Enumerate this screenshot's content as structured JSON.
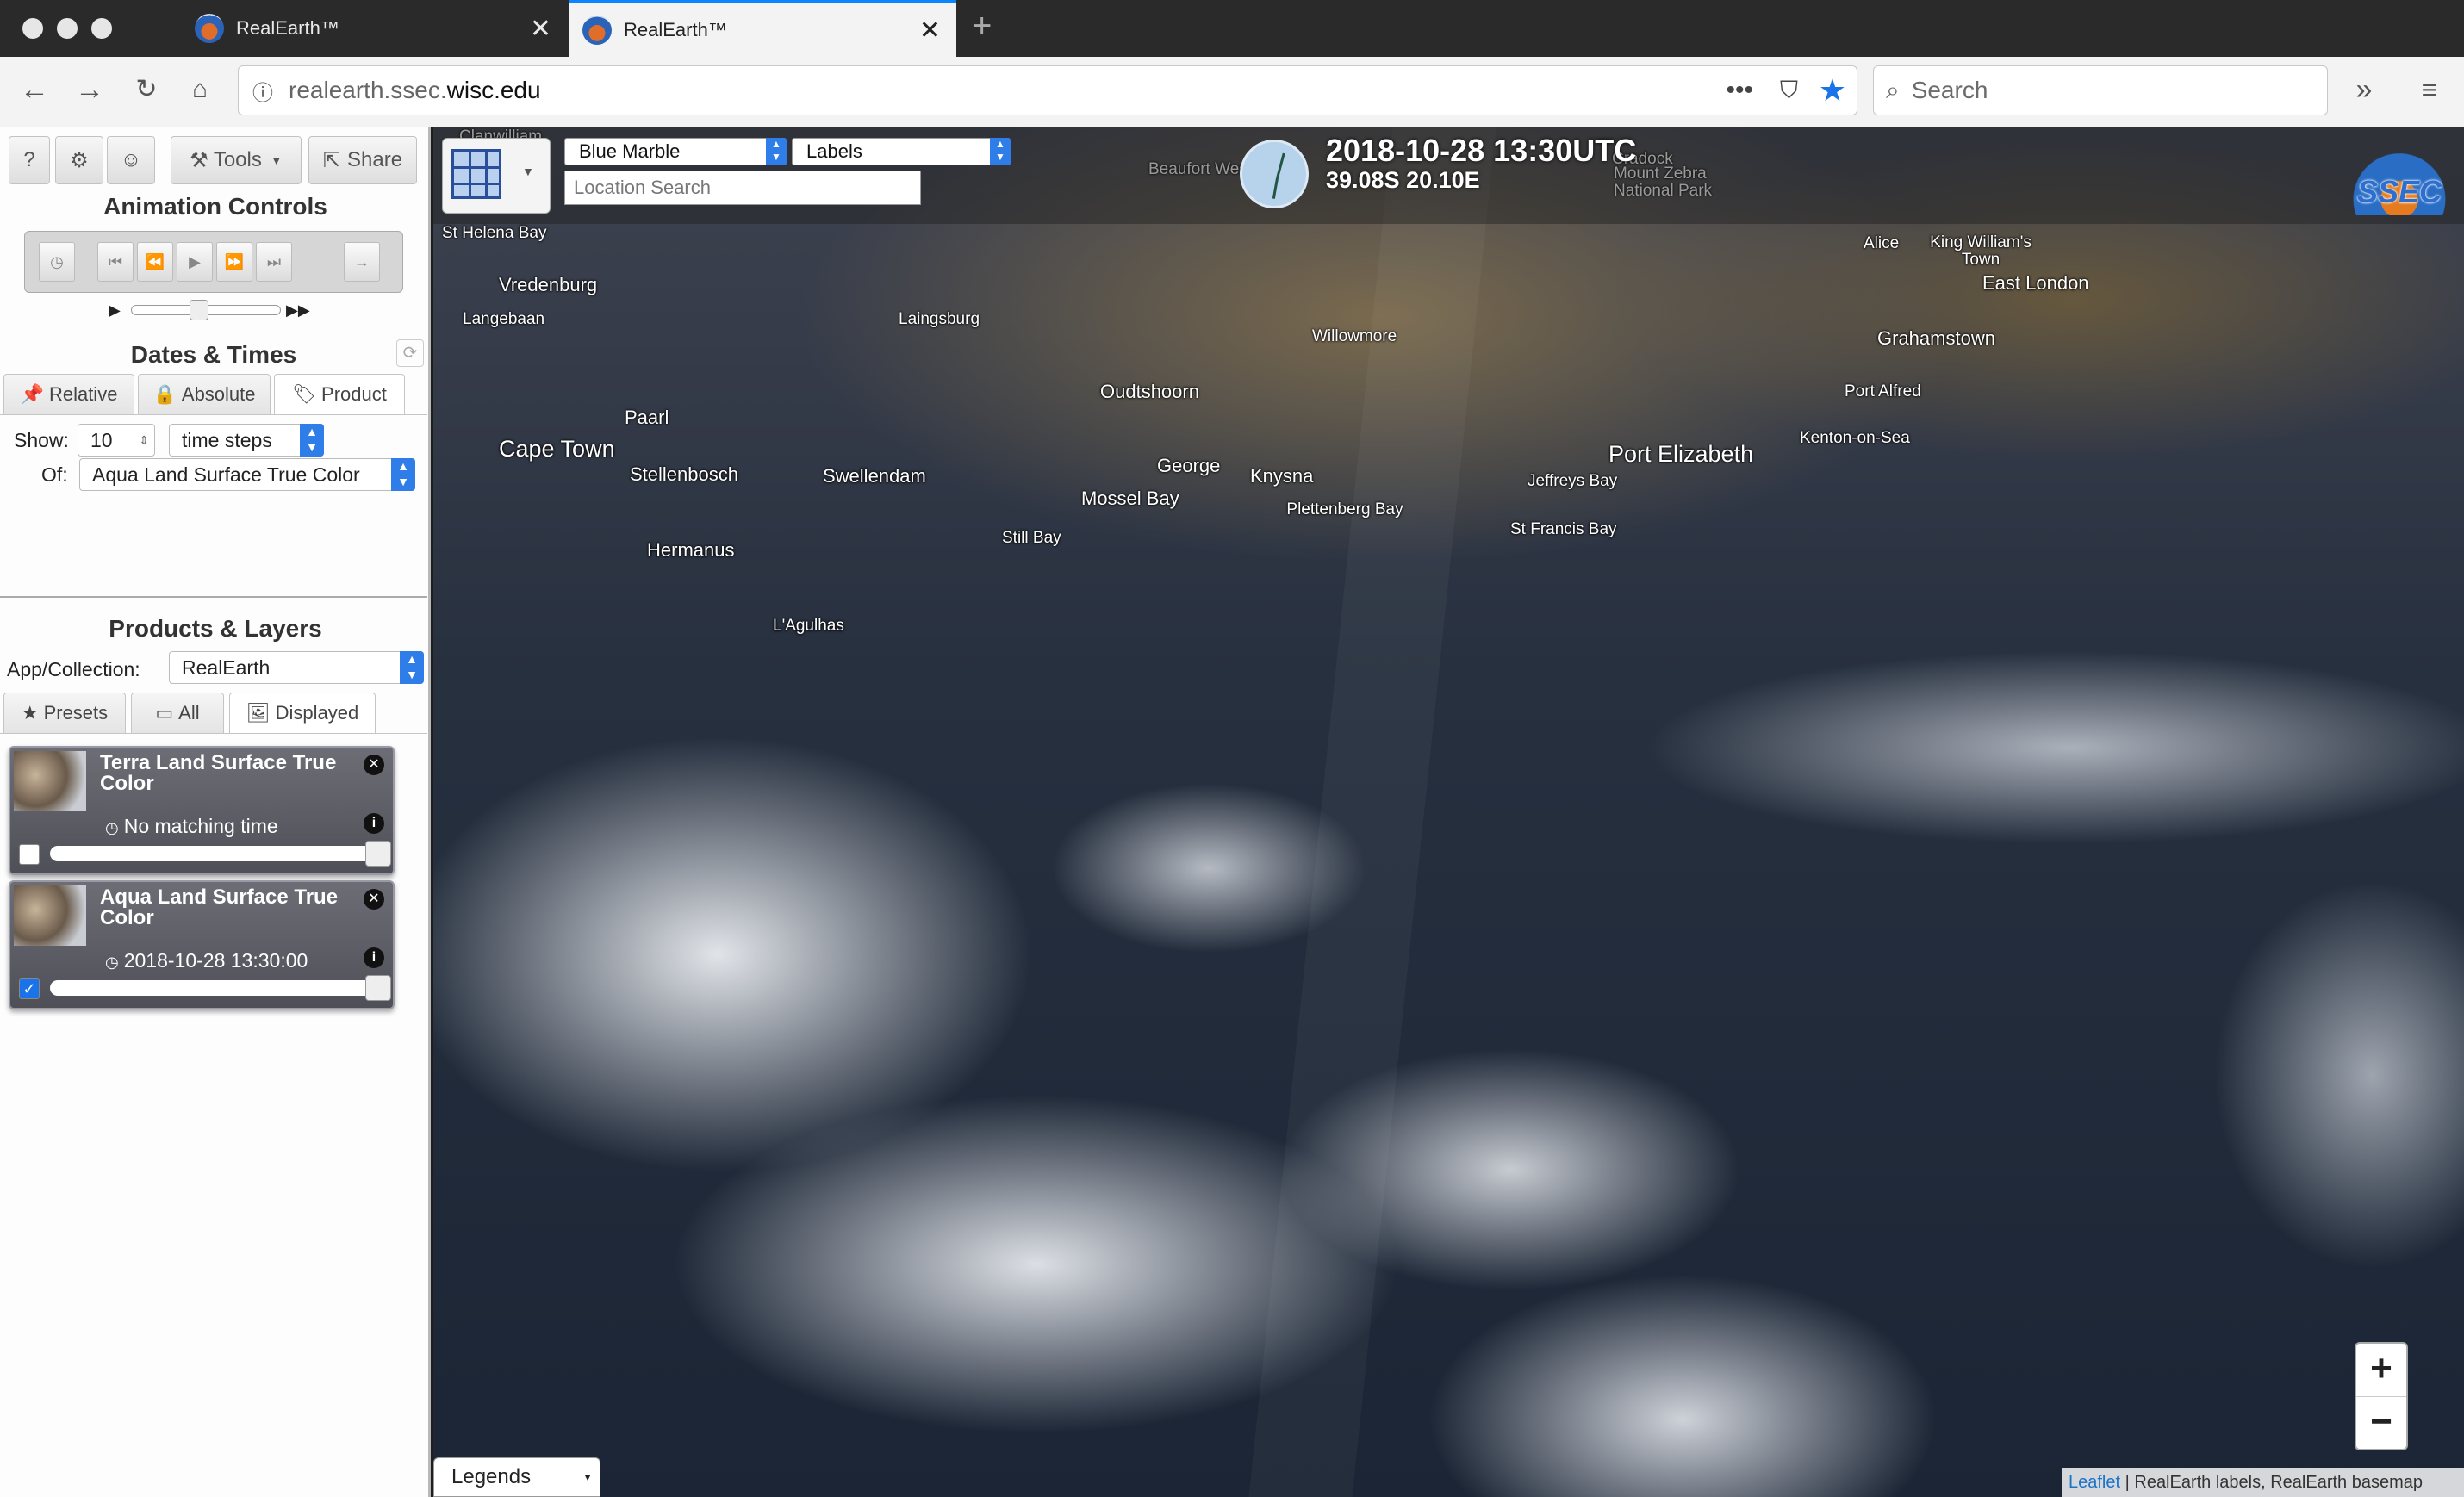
{
  "browser": {
    "tabs": [
      {
        "title": "RealEarth™",
        "active": false
      },
      {
        "title": "RealEarth™",
        "active": true
      }
    ],
    "url_prefix": "realearth.ssec.",
    "url_domain": "wisc.edu",
    "search_placeholder": "Search"
  },
  "toolbar": {
    "help": "?",
    "tools": "Tools",
    "share": "Share"
  },
  "animation": {
    "title": "Animation Controls"
  },
  "dates": {
    "title": "Dates & Times",
    "tabs": [
      "Relative",
      "Absolute",
      "Product"
    ],
    "show_label": "Show:",
    "show_value": "10",
    "unit": "time steps",
    "of_label": "Of:",
    "product": "Aqua Land Surface True Color"
  },
  "products": {
    "title": "Products & Layers",
    "collection_label": "App/Collection:",
    "collection_value": "RealEarth",
    "tabs": [
      "Presets",
      "All",
      "Displayed"
    ],
    "layers": [
      {
        "title": "Terra Land Surface True Color",
        "time": "No matching time",
        "checked": false
      },
      {
        "title": "Aqua Land Surface True Color",
        "time": "2018-10-28 13:30:00",
        "checked": true
      }
    ]
  },
  "map": {
    "basemap": "Blue Marble",
    "labels": "Labels",
    "location_placeholder": "Location Search",
    "datetime": "2018-10-28 13:30UTC",
    "coords": "39.08S 20.10E",
    "logo": "SSEC",
    "zoom_in": "+",
    "zoom_out": "−",
    "attribution_link": "Leaflet",
    "attribution_text": " | RealEarth labels, RealEarth basemap",
    "legends": "Legends",
    "places": [
      "Clanwilliam",
      "Beaufort West",
      "Cradock",
      "Mount Zebra National Park",
      "St Helena Bay",
      "Vredenburg",
      "Langebaan",
      "Laingsburg",
      "Willowmore",
      "Alice",
      "King William's Town",
      "East London",
      "Grahamstown",
      "Oudtshoorn",
      "Paarl",
      "Cape Town",
      "Stellenbosch",
      "Swellendam",
      "George",
      "Mossel Bay",
      "Knysna",
      "Plettenberg Bay",
      "Port Alfred",
      "Kenton-on-Sea",
      "Port Elizabeth",
      "Jeffreys Bay",
      "St Francis Bay",
      "Hermanus",
      "Still Bay",
      "L'Agulhas"
    ]
  }
}
